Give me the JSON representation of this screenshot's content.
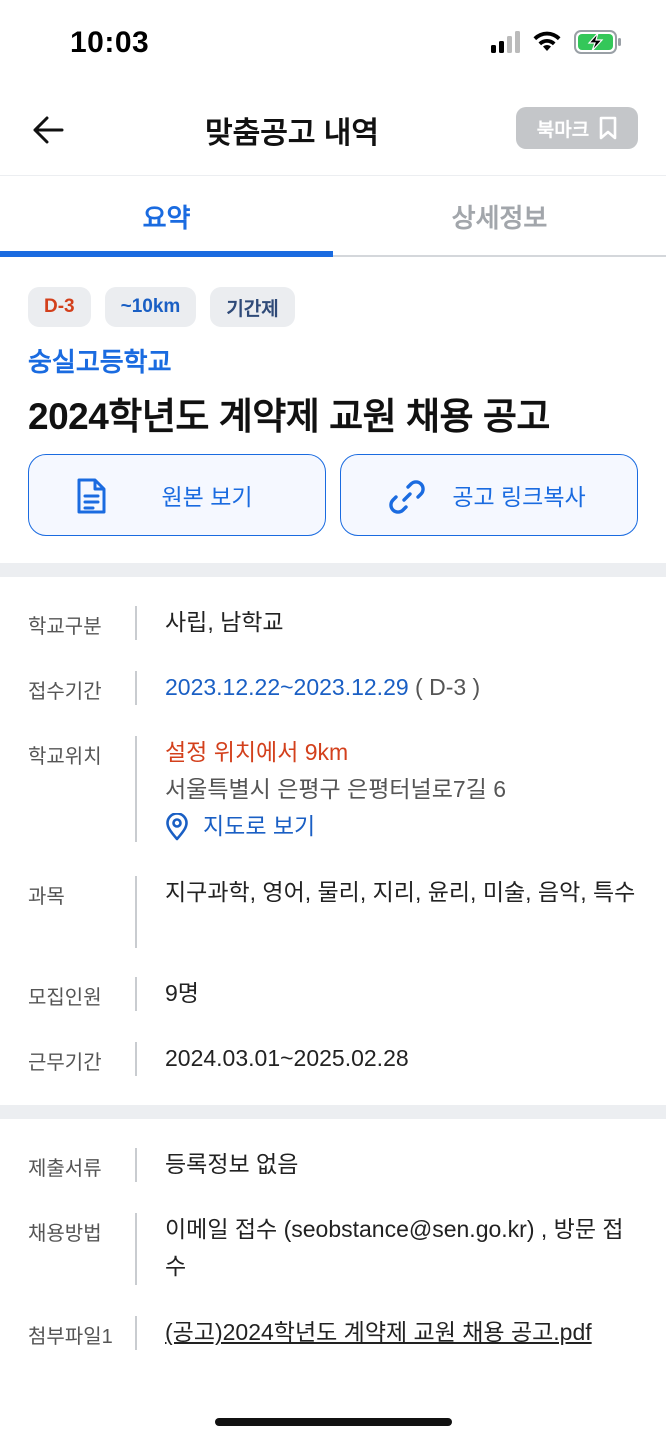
{
  "status": {
    "time": "10:03"
  },
  "header": {
    "title": "맞춤공고 내역",
    "bookmark_label": "북마크"
  },
  "tabs": [
    {
      "label": "요약",
      "active": true
    },
    {
      "label": "상세정보",
      "active": false
    }
  ],
  "chips": [
    "D-3",
    "~10km",
    "기간제"
  ],
  "school_name": "숭실고등학교",
  "job_title": "2024학년도 계약제 교원 채용 공고",
  "actions": {
    "view_original": "원본 보기",
    "copy_link": "공고 링크복사"
  },
  "info": {
    "school_type": {
      "label": "학교구분",
      "value": "사립, 남학교"
    },
    "period": {
      "label": "접수기간",
      "value": "2023.12.22~2023.12.29",
      "dday": "( D-3 )"
    },
    "location": {
      "label": "학교위치",
      "distance": "설정 위치에서 9km",
      "address": "서울특별시 은평구 은평터널로7길 6",
      "map_link": "지도로 보기"
    },
    "subjects": {
      "label": "과목",
      "value": "지구과학, 영어, 물리, 지리, 윤리, 미술, 음악, 특수"
    },
    "recruits": {
      "label": "모집인원",
      "value": "9명"
    },
    "work_period": {
      "label": "근무기간",
      "value": "2024.03.01~2025.02.28"
    }
  },
  "docs": {
    "documents": {
      "label": "제출서류",
      "value": "등록정보 없음"
    },
    "method": {
      "label": "채용방법",
      "value": "이메일 접수 (seobstance@sen.go.kr) , 방문 접수"
    },
    "attachment": {
      "label": "첨부파일1",
      "value": "(공고)2024학년도 계약제 교원 채용 공고.pdf"
    }
  },
  "colors": {
    "accent": "#1a6be0",
    "alert": "#d3401c"
  }
}
